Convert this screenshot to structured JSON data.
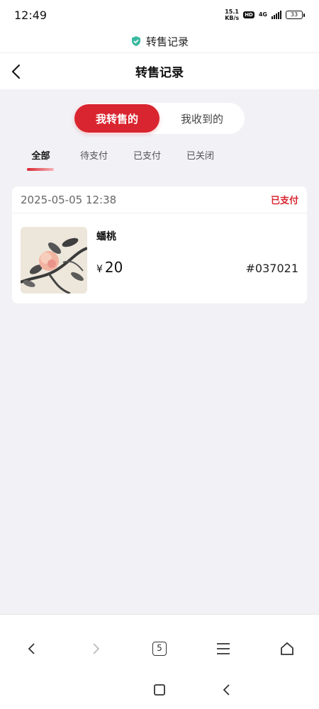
{
  "status_bar": {
    "time": "12:49",
    "net_speed_value": "15.1",
    "net_speed_unit": "KB/s",
    "hd": "HD",
    "network": "4G",
    "battery": "33"
  },
  "url_bar": {
    "title": "转售记录",
    "icon": "shield-icon"
  },
  "header": {
    "title": "转售记录",
    "back_icon": "chevron-left-icon"
  },
  "segment": {
    "items": [
      "我转售的",
      "我收到的"
    ],
    "selected": 0
  },
  "tabs": {
    "items": [
      "全部",
      "待支付",
      "已支付",
      "已关闭"
    ],
    "selected": 0
  },
  "orders": [
    {
      "time": "2025-05-05 12:38",
      "status": "已支付",
      "name": "蟠桃",
      "currency": "¥",
      "price": "20",
      "number": "#037021"
    }
  ],
  "browser_toolbar": {
    "tab_count": "5"
  },
  "colors": {
    "accent": "#d9252f",
    "background": "#f1f1f6"
  }
}
